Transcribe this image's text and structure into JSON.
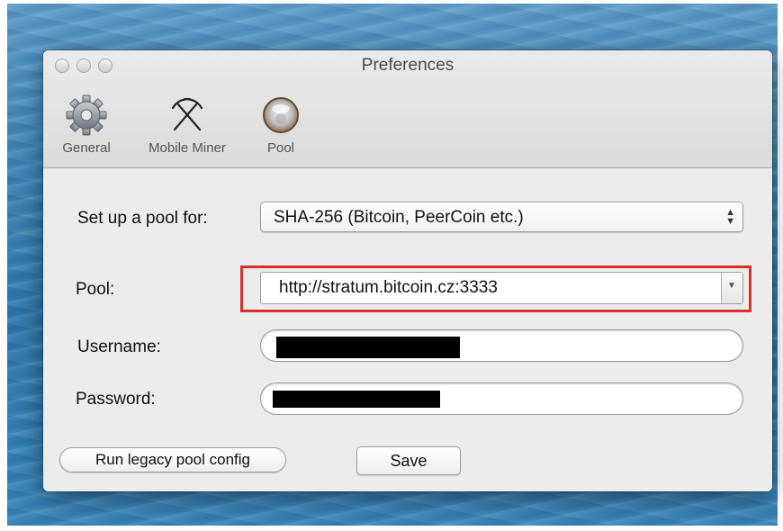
{
  "window": {
    "title": "Preferences"
  },
  "toolbar": {
    "items": [
      {
        "label": "General",
        "icon": "gear-icon"
      },
      {
        "label": "Mobile Miner",
        "icon": "pickaxes-icon"
      },
      {
        "label": "Pool",
        "icon": "pool-sphere-icon"
      }
    ]
  },
  "form": {
    "setup_label": "Set up a pool for:",
    "setup_value": "SHA-256 (Bitcoin, PeerCoin etc.)",
    "pool_label": "Pool:",
    "pool_value": "http://stratum.bitcoin.cz:3333",
    "username_label": "Username:",
    "password_label": "Password:"
  },
  "buttons": {
    "legacy": "Run legacy pool config",
    "save": "Save"
  },
  "colors": {
    "highlight": "#d8322e"
  }
}
